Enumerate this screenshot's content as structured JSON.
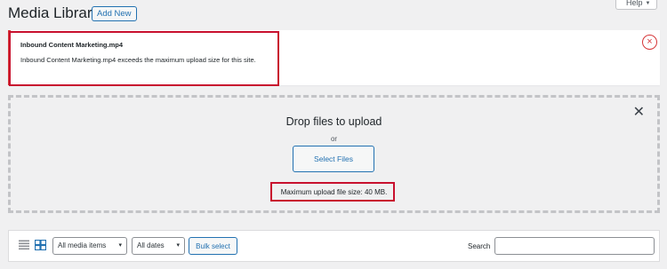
{
  "header": {
    "title": "Media Library",
    "add_new_label": "Add New",
    "help_label": "Help"
  },
  "error_notice": {
    "filename": "Inbound Content Marketing.mp4",
    "message": "Inbound Content Marketing.mp4 exceeds the maximum upload size for this site.",
    "dismiss_icon": "×"
  },
  "uploader": {
    "drop_title": "Drop files to upload",
    "or_text": "or",
    "select_files_label": "Select Files",
    "max_upload_text": "Maximum upload file size: 40 MB.",
    "close_icon": "✕"
  },
  "toolbar": {
    "filter_type_value": "All media items",
    "filter_date_value": "All dates",
    "bulk_select_label": "Bulk select",
    "search_label": "Search",
    "search_value": ""
  },
  "colors": {
    "accent": "#2271b1",
    "error": "#d63638",
    "highlight": "#c8102e",
    "background": "#f0f0f1"
  }
}
